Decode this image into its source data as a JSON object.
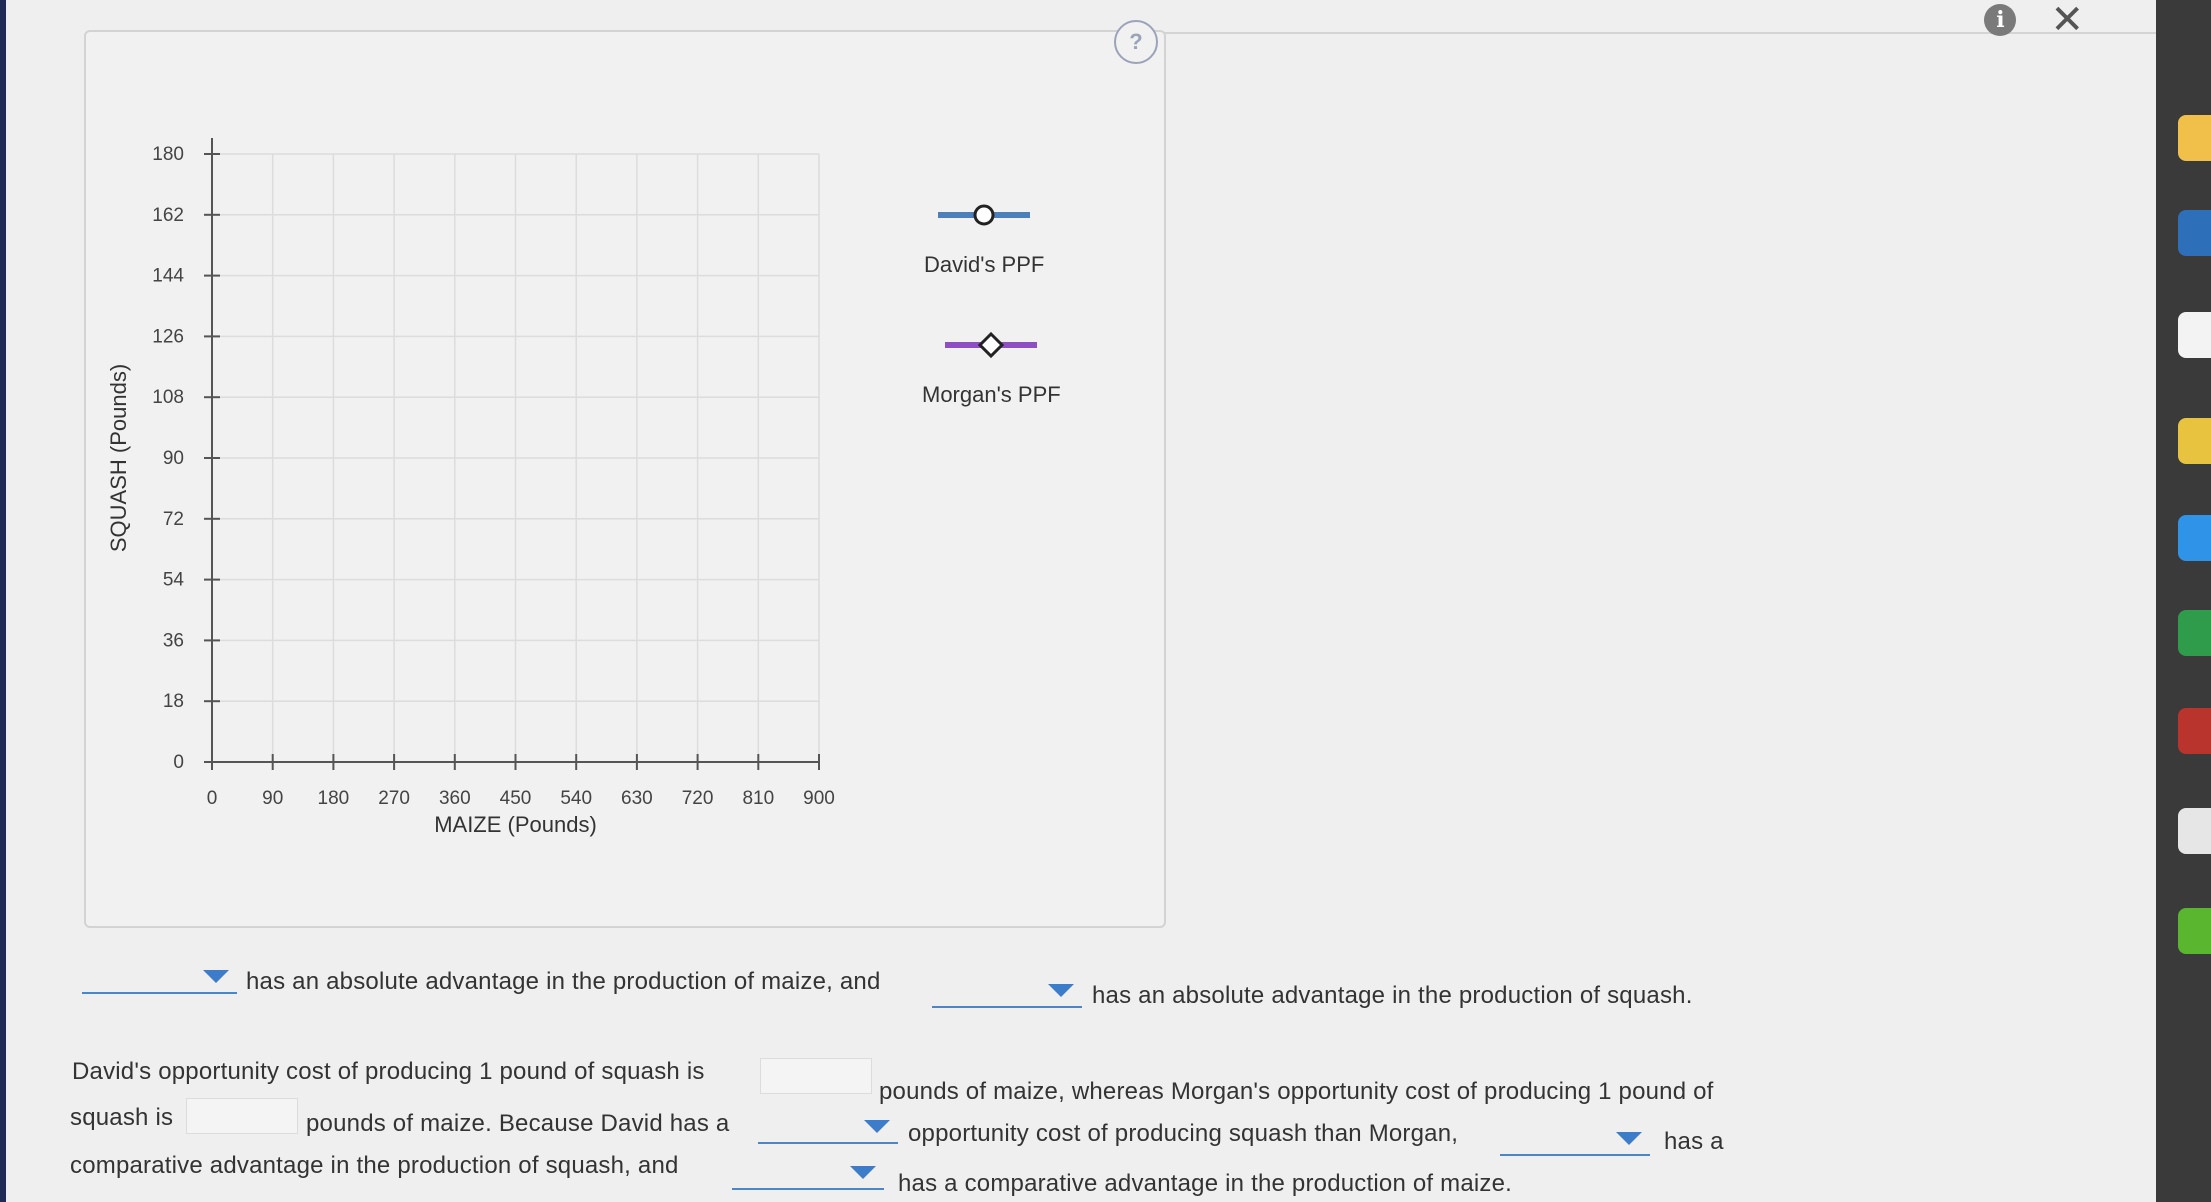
{
  "chart_data": {
    "type": "line",
    "xlabel": "MAIZE (Pounds)",
    "ylabel": "SQUASH (Pounds)",
    "xlim": [
      0,
      900
    ],
    "ylim": [
      0,
      180
    ],
    "x_ticks": [
      0,
      90,
      180,
      270,
      360,
      450,
      540,
      630,
      720,
      810,
      900
    ],
    "y_ticks": [
      0,
      18,
      36,
      54,
      72,
      90,
      108,
      126,
      144,
      162,
      180
    ],
    "grid": true,
    "legend_position": "right",
    "series": [
      {
        "name": "David's PPF",
        "marker": "circle",
        "color": "#4f7fb8",
        "points": []
      },
      {
        "name": "Morgan's PPF",
        "marker": "diamond",
        "color": "#8d4fc2",
        "points": []
      }
    ]
  },
  "toolbar": {
    "info_icon": "info-icon",
    "close_icon": "close-icon",
    "help_icon": "help-circle-icon"
  },
  "questions": {
    "absolute": {
      "part1": "has an absolute advantage in the production of maize, and",
      "part2": "has an absolute advantage in the production of squash."
    },
    "comparative": {
      "line1a": "David's opportunity cost of producing 1 pound of squash is",
      "line1b": "pounds of maize, whereas Morgan's opportunity cost of producing 1 pound of",
      "line2a": "squash is",
      "line2b": "pounds of maize. Because David has a",
      "line2c": "opportunity cost of producing squash than Morgan,",
      "line2d": "has a",
      "line3a": "comparative advantage in the production of squash, and",
      "line3b": "has a comparative advantage in the production of maize."
    }
  },
  "inputs": {
    "david_cost": "",
    "morgan_cost": ""
  },
  "dropdowns": {
    "maize_abs": "",
    "squash_abs": "",
    "lower_higher": "",
    "squash_comp_who": "",
    "maize_comp_who": ""
  }
}
